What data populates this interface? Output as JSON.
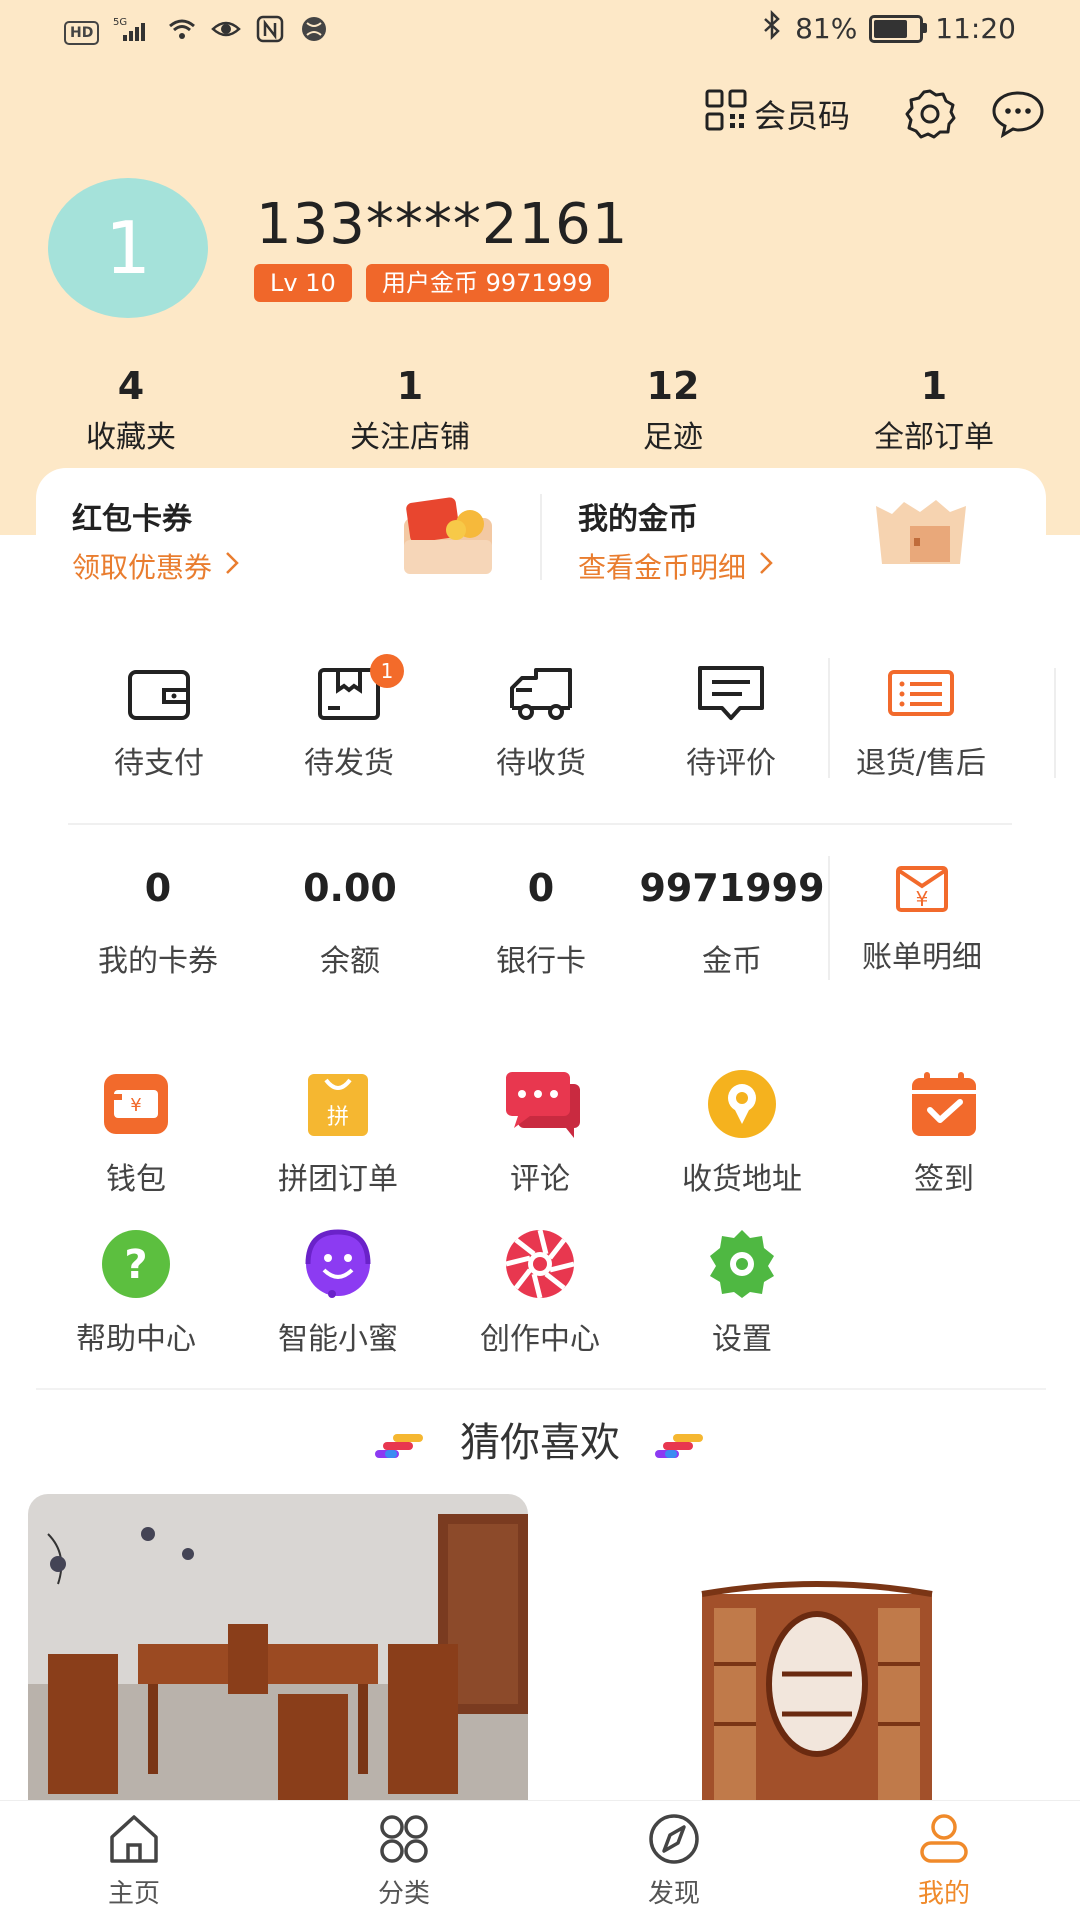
{
  "status_bar": {
    "left_badges": [
      "HD",
      "5G"
    ],
    "bluetooth_icon": "bluetooth-icon",
    "battery_percent": "81%",
    "battery_level": 0.81,
    "time": "11:20"
  },
  "header": {
    "member_code_label": "会员码",
    "settings_icon": "gear-icon",
    "message_icon": "chat-bubble-icon"
  },
  "profile": {
    "avatar_text": "1",
    "phone": "133****2161",
    "level": "Lv 10",
    "coins_badge": "用户金币 9971999"
  },
  "stats": [
    {
      "value": "4",
      "label": "收藏夹"
    },
    {
      "value": "1",
      "label": "关注店铺"
    },
    {
      "value": "12",
      "label": "足迹"
    },
    {
      "value": "1",
      "label": "全部订单"
    }
  ],
  "cards": {
    "coupon": {
      "title": "红包卡券",
      "link": "领取优惠券"
    },
    "coins": {
      "title": "我的金币",
      "link": "查看金币明细"
    }
  },
  "orders": [
    {
      "label": "待支付",
      "icon": "wallet-icon"
    },
    {
      "label": "待发货",
      "icon": "box-icon",
      "badge": "1"
    },
    {
      "label": "待收货",
      "icon": "truck-icon"
    },
    {
      "label": "待评价",
      "icon": "comment-icon"
    },
    {
      "label": "退货/售后",
      "icon": "list-icon"
    }
  ],
  "assets": [
    {
      "value": "0",
      "label": "我的卡券"
    },
    {
      "value": "0.00",
      "label": "余额"
    },
    {
      "value": "0",
      "label": "银行卡"
    },
    {
      "value": "9971999",
      "label": "金币"
    },
    {
      "label": "账单明细",
      "icon": "bill-icon"
    }
  ],
  "tools": [
    {
      "label": "钱包",
      "icon": "wallet-icon",
      "color": "#f26a2c"
    },
    {
      "label": "拼团订单",
      "icon": "bag-icon",
      "color": "#f5b731"
    },
    {
      "label": "评论",
      "icon": "chat-icon",
      "color": "#e8374f"
    },
    {
      "label": "收货地址",
      "icon": "location-icon",
      "color": "#f5b21e"
    },
    {
      "label": "签到",
      "icon": "calendar-check-icon",
      "color": "#f26a2c"
    },
    {
      "label": "帮助中心",
      "icon": "help-icon",
      "color": "#5cbf3f"
    },
    {
      "label": "智能小蜜",
      "icon": "robot-icon",
      "color": "#8c3bf2"
    },
    {
      "label": "创作中心",
      "icon": "aperture-icon",
      "color": "#e8374f"
    },
    {
      "label": "设置",
      "icon": "gear-icon",
      "color": "#4fb842"
    }
  ],
  "guess": {
    "title": "猜你喜欢"
  },
  "tabs": [
    {
      "label": "主页",
      "icon": "home-icon"
    },
    {
      "label": "分类",
      "icon": "category-icon"
    },
    {
      "label": "发现",
      "icon": "compass-icon"
    },
    {
      "label": "我的",
      "icon": "user-icon",
      "active": true
    }
  ],
  "colors": {
    "header_bg": "#fde8c7",
    "accent": "#f0672a",
    "link": "#e97d2f",
    "avatar": "#a5e2da",
    "tab_active": "#f08a2a"
  }
}
